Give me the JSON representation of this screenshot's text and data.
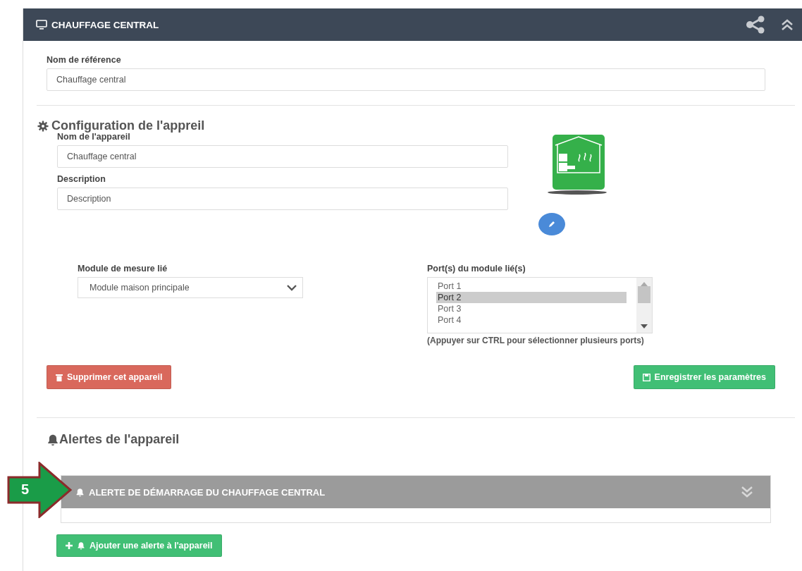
{
  "panel": {
    "title": "CHAUFFAGE CENTRAL"
  },
  "reference": {
    "label": "Nom de référence",
    "value": "Chauffage central"
  },
  "config": {
    "heading": "Configuration de l'appreil",
    "name": {
      "label": "Nom de l'appareil",
      "value": "Chauffage central"
    },
    "description": {
      "label": "Description",
      "placeholder": "Description"
    },
    "module": {
      "label": "Module de mesure lié",
      "value": "Module maison principale"
    },
    "ports": {
      "label": "Port(s) du module lié(s)",
      "hint": "(Appuyer sur CTRL pour sélectionner plusieurs ports)",
      "items": [
        {
          "label": "Port 1",
          "selected": false
        },
        {
          "label": "Port 2",
          "selected": true
        },
        {
          "label": "Port 3",
          "selected": false
        },
        {
          "label": "Port 4",
          "selected": false
        }
      ]
    },
    "delete_button": "Supprimer cet appareil",
    "save_button": "Enregistrer les paramètres"
  },
  "alerts": {
    "heading": "Alertes de l'appareil",
    "items": [
      {
        "title": "ALERTE DE DÉMARRAGE DU CHAUFFAGE CENTRAL",
        "expanded": false
      }
    ],
    "add_button": "Ajouter une alerte à l'appareil"
  },
  "callout": {
    "label": "5"
  }
}
